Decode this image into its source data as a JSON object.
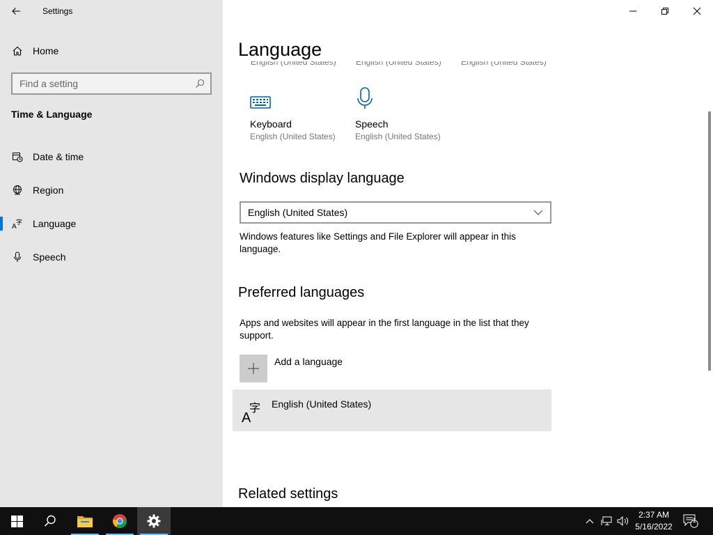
{
  "window": {
    "app_title": "Settings"
  },
  "sidebar": {
    "home_label": "Home",
    "search_placeholder": "Find a setting",
    "section_heading": "Time & Language",
    "items": [
      {
        "label": "Date & time",
        "icon": "calendar-clock-icon"
      },
      {
        "label": "Region",
        "icon": "globe-icon"
      },
      {
        "label": "Language",
        "icon": "language-icon",
        "selected": true
      },
      {
        "label": "Speech",
        "icon": "microphone-icon"
      }
    ]
  },
  "main": {
    "page_title": "Language",
    "clipped_subtitles": [
      "English (United States)",
      "English (United States)",
      "English (United States)"
    ],
    "tiles": [
      {
        "title": "Keyboard",
        "subtitle": "English (United States)",
        "icon": "keyboard-icon"
      },
      {
        "title": "Speech",
        "subtitle": "English (United States)",
        "icon": "microphone-icon"
      }
    ],
    "display_language": {
      "heading": "Windows display language",
      "selected": "English (United States)",
      "description": "Windows features like Settings and File Explorer will appear in this language."
    },
    "preferred": {
      "heading": "Preferred languages",
      "description": "Apps and websites will appear in the first language in the list that they support.",
      "add_label": "Add a language",
      "languages": [
        "English (United States)"
      ]
    },
    "related_heading": "Related settings"
  },
  "taskbar": {
    "time": "2:37 AM",
    "date": "5/16/2022",
    "notification_count": "1",
    "accent": "#76b9ed"
  },
  "colors": {
    "sidebar_bg": "#e6e6e6",
    "accent": "#0078d7",
    "taskbar_bg": "#101010"
  }
}
